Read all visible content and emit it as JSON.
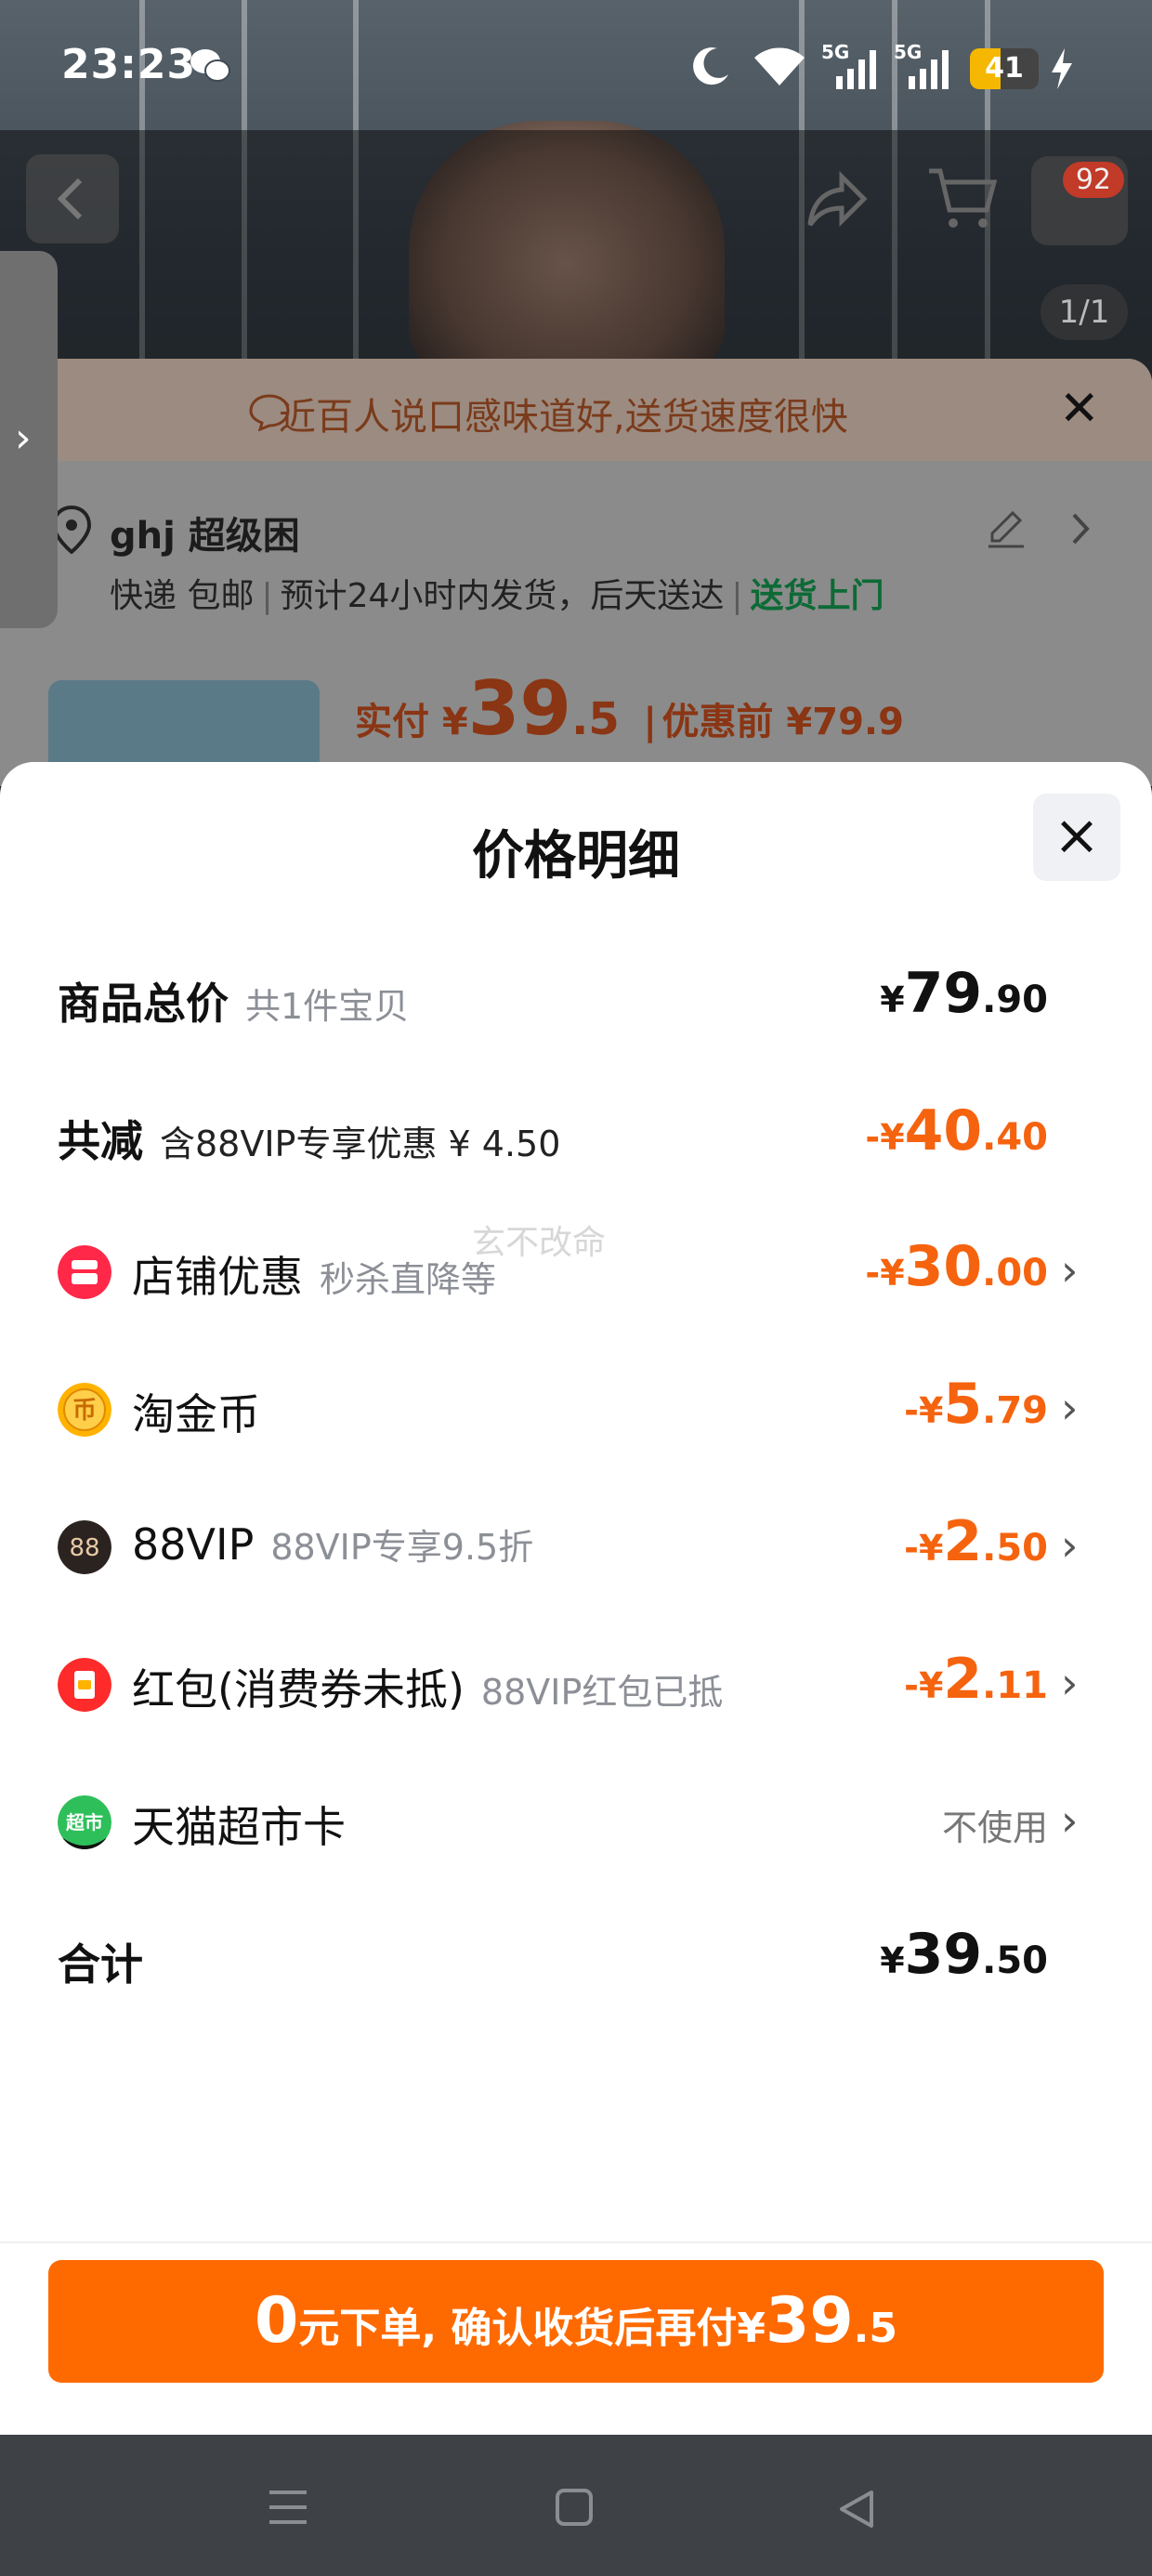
{
  "status_bar": {
    "time": "23:23",
    "battery": "41",
    "network_1": "5G",
    "network_2": "5G"
  },
  "background_page": {
    "cart_badge_count": "92",
    "image_counter": "1/1",
    "banner_text": "近百人说口感味道好,送货速度很快",
    "address_name": "ghj 超级困",
    "delivery_info": {
      "method": "快递 包邮",
      "ship_time": "预计24小时内发货，后天送达",
      "door_delivery": "送货上门"
    },
    "price_paid_label": "实付 ¥",
    "price_paid_int": "39",
    "price_paid_frac": ".5",
    "price_before_label": "优惠前 ¥79.9"
  },
  "sheet": {
    "title": "价格明细",
    "watermark": "玄不改命",
    "rows": [
      {
        "label": "商品总价",
        "sub": "共1件宝贝",
        "cur": "¥",
        "int": "79",
        "frac": ".90"
      },
      {
        "label": "共减",
        "sub": "含88VIP专享优惠 ¥ 4.50",
        "cur": "-¥",
        "int": "40",
        "frac": ".40"
      },
      {
        "label": "店铺优惠",
        "sub": "秒杀直降等",
        "cur": "-¥",
        "int": "30",
        "frac": ".00",
        "icon": "store-icon"
      },
      {
        "label": "淘金币",
        "sub": "",
        "cur": "-¥",
        "int": "5",
        "frac": ".79",
        "icon": "coin-icon"
      },
      {
        "label": "88VIP",
        "sub": "88VIP专享9.5折",
        "cur": "-¥",
        "int": "2",
        "frac": ".50",
        "icon": "vip-88-icon"
      },
      {
        "label": "红包(消费券未抵)",
        "sub": "88VIP红包已抵",
        "cur": "-¥",
        "int": "2",
        "frac": ".11",
        "icon": "red-packet-icon"
      },
      {
        "label": "天猫超市卡",
        "sub": "",
        "value": "不使用",
        "icon": "tmall-supermarket-icon"
      },
      {
        "label": "合计",
        "sub": "",
        "cur": "¥",
        "int": "39",
        "frac": ".50"
      }
    ],
    "cta": {
      "zero": "0",
      "text": "元下单, 确认收货后再付",
      "cur": "¥",
      "int": "39",
      "frac": ".5"
    }
  },
  "colors": {
    "accent_orange": "#ff6a00",
    "discount_orange": "#f5630f",
    "green": "#0d6a36"
  }
}
